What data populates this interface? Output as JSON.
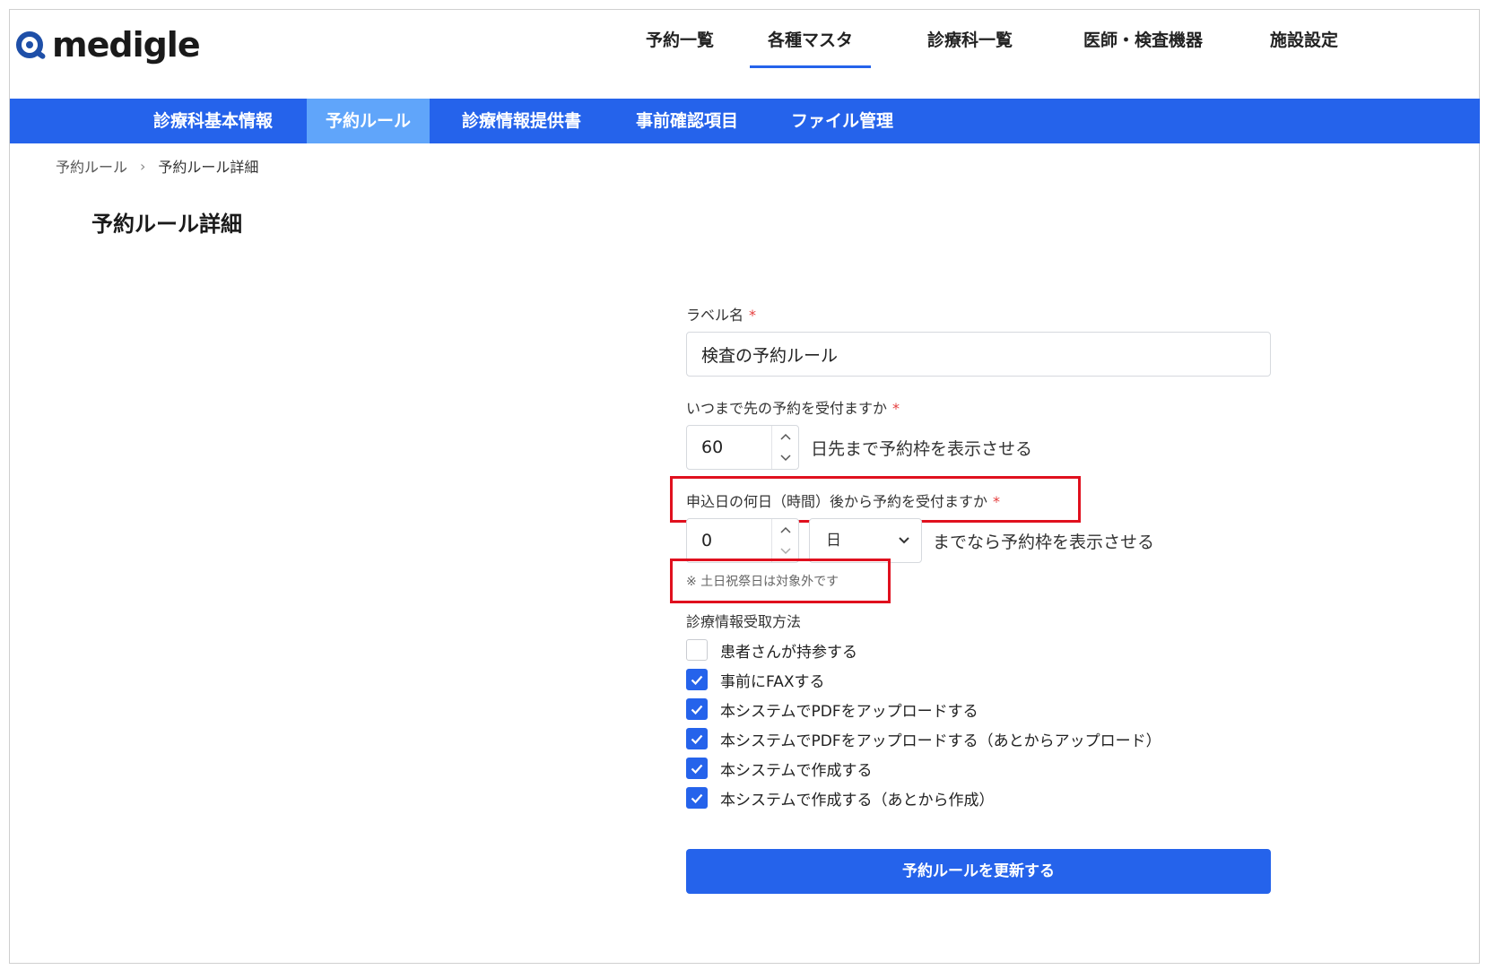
{
  "brand": {
    "name": "medigle",
    "accent": "#2563eb",
    "accent_light": "#60a5fa",
    "required_color": "#e53e3e",
    "highlight_color": "#e0101e"
  },
  "top_nav": {
    "items": [
      {
        "label": "予約一覧",
        "active": false
      },
      {
        "label": "各種マスタ",
        "active": true
      },
      {
        "label": "診療科一覧",
        "active": false
      },
      {
        "label": "医師・検査機器",
        "active": false
      },
      {
        "label": "施設設定",
        "active": false
      }
    ]
  },
  "sub_nav": {
    "items": [
      {
        "label": "診療科基本情報",
        "active": false
      },
      {
        "label": "予約ルール",
        "active": true
      },
      {
        "label": "診療情報提供書",
        "active": false
      },
      {
        "label": "事前確認項目",
        "active": false
      },
      {
        "label": "ファイル管理",
        "active": false
      }
    ]
  },
  "breadcrumb": {
    "parent": "予約ルール",
    "separator": "›",
    "current": "予約ルール詳細"
  },
  "page_title": "予約ルール詳細",
  "form": {
    "label_name": {
      "label": "ラベル名",
      "required_mark": "*",
      "value": "検査の予約ルール"
    },
    "accept_until": {
      "label": "いつまで先の予約を受付ますか",
      "required_mark": "*",
      "value": "60",
      "suffix": "日先まで予約枠を表示させる"
    },
    "accept_after": {
      "label": "申込日の何日（時間）後から予約を受付ますか",
      "required_mark": "*",
      "value": "0",
      "unit_selected": "日",
      "suffix": "までなら予約枠を表示させる",
      "note": "※ 土日祝祭日は対象外です"
    },
    "info_method": {
      "label": "診療情報受取方法",
      "options": [
        {
          "label": "患者さんが持参する",
          "checked": false
        },
        {
          "label": "事前にFAXする",
          "checked": true
        },
        {
          "label": "本システムでPDFをアップロードする",
          "checked": true
        },
        {
          "label": "本システムでPDFをアップロードする（あとからアップロード）",
          "checked": true
        },
        {
          "label": "本システムで作成する",
          "checked": true
        },
        {
          "label": "本システムで作成する（あとから作成）",
          "checked": true
        }
      ]
    },
    "submit_label": "予約ルールを更新する"
  },
  "icons": {
    "logo": "magnifier-logo-icon",
    "breadcrumb_sep": "chevron-right-icon",
    "spin_up": "chevron-up-icon",
    "spin_down": "chevron-down-icon",
    "select": "chevron-down-icon",
    "check": "check-icon"
  }
}
